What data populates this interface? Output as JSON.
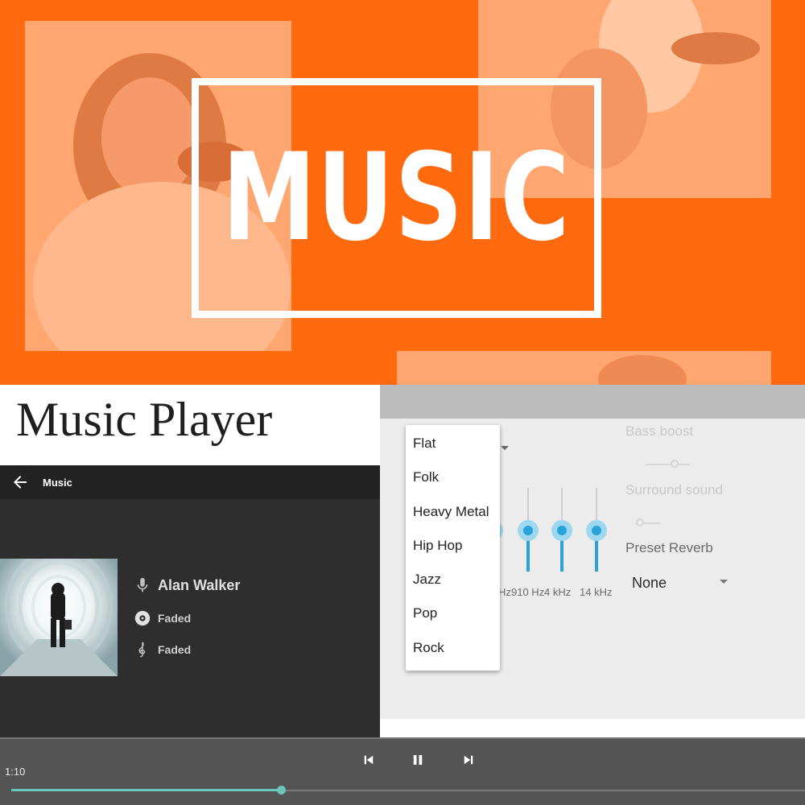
{
  "banner": {
    "logo_text": "MUSIC",
    "bg_color": "#ff6a0e",
    "photo_tint": "#ffa671"
  },
  "caption": "Music Player",
  "player": {
    "title": "Music",
    "artist": "Alan Walker",
    "album": "Faded",
    "track": "Faded",
    "icons": [
      "back-arrow-icon",
      "microphone-icon",
      "disc-icon",
      "treble-clef-icon"
    ]
  },
  "equalizer": {
    "bass_boost_label": "Bass boost",
    "surround_label": "Surround sound",
    "preset_reverb_label": "Preset Reverb",
    "preset_reverb_value": "None",
    "band_labels": [
      "Hz",
      "910 Hz",
      "4 kHz",
      "14 kHz"
    ],
    "band_levels": [
      0.5,
      0.5,
      0.5,
      0.5
    ],
    "accent_color": "#2aa4d8"
  },
  "preset_menu": {
    "items": [
      "Flat",
      "Folk",
      "Heavy Metal",
      "Hip Hop",
      "Jazz",
      "Pop",
      "Rock"
    ]
  },
  "transport": {
    "elapsed": "1:10",
    "progress": 0.34,
    "icons": [
      "skip-previous-icon",
      "pause-icon",
      "skip-next-icon"
    ],
    "accent_color": "#69c6b8"
  }
}
